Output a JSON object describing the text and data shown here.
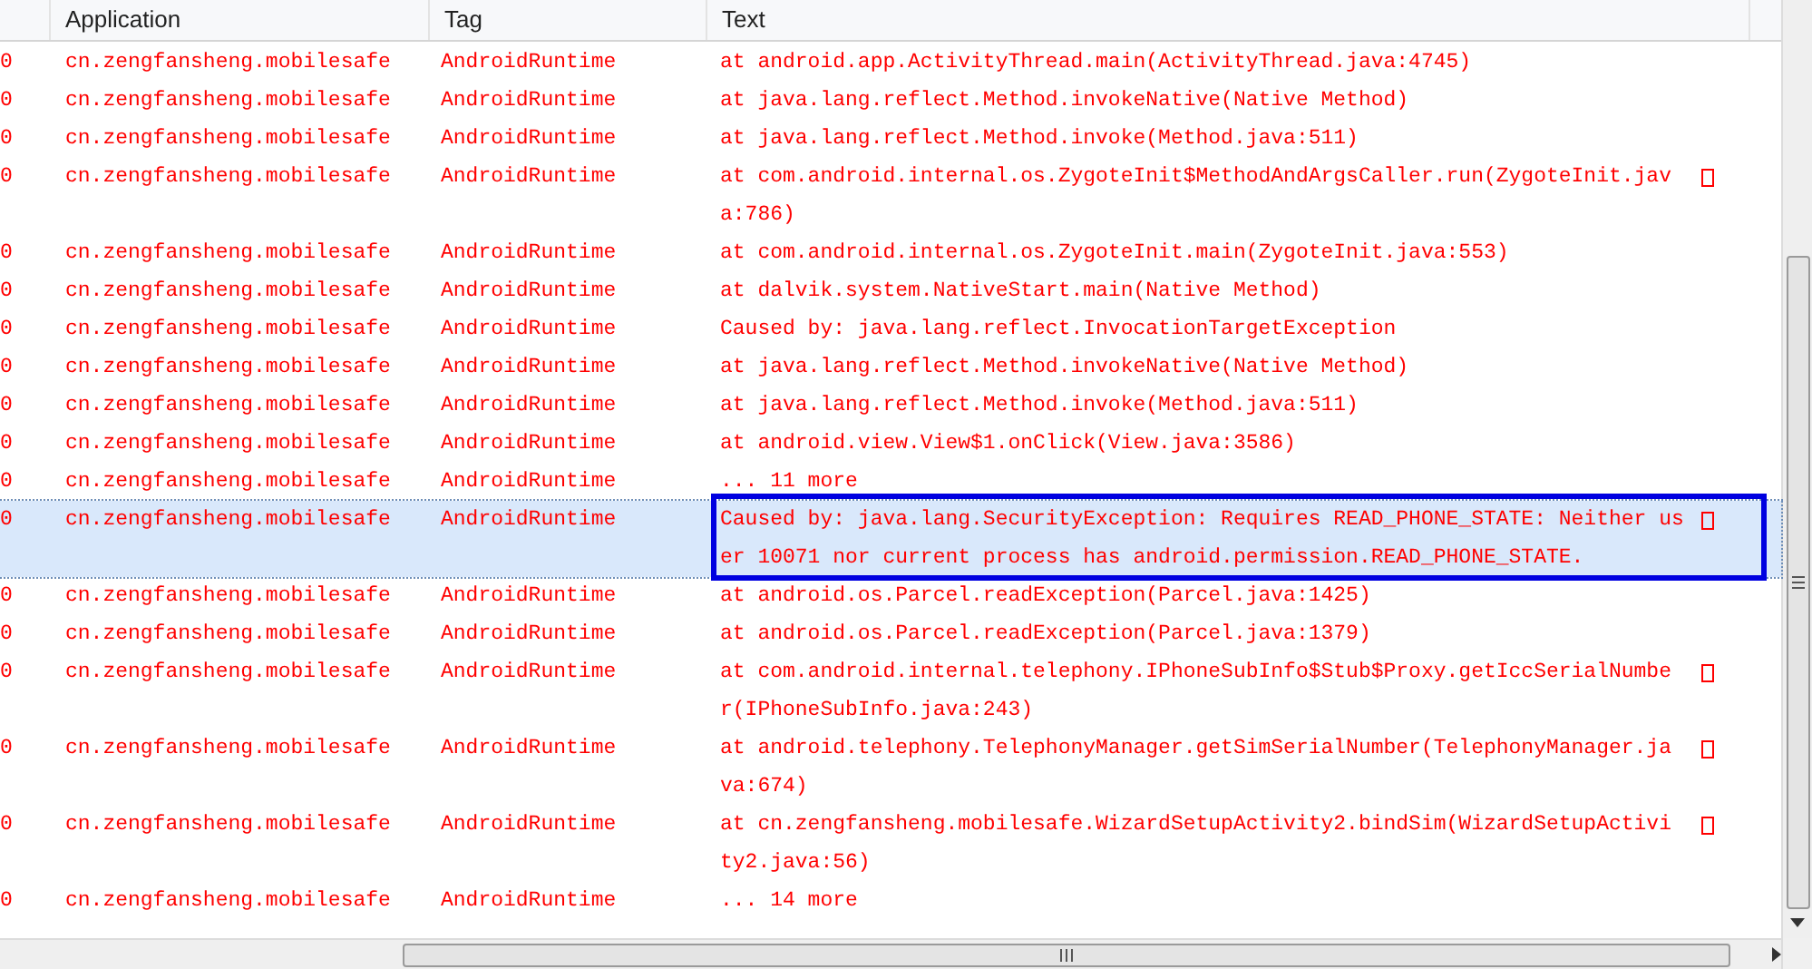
{
  "table": {
    "columns": [
      "Application",
      "Tag",
      "Text"
    ],
    "rows": [
      {
        "column_1": "0",
        "application": "cn.zengfansheng.mobilesafe",
        "tag": "AndroidRuntime",
        "text": [
          "at android.app.ActivityThread.main(ActivityThread.java:4745)"
        ],
        "selected": false
      },
      {
        "column_1": "0",
        "application": "cn.zengfansheng.mobilesafe",
        "tag": "AndroidRuntime",
        "text": [
          "at java.lang.reflect.Method.invokeNative(Native Method)"
        ],
        "selected": false
      },
      {
        "column_1": "0",
        "application": "cn.zengfansheng.mobilesafe",
        "tag": "AndroidRuntime",
        "text": [
          "at java.lang.reflect.Method.invoke(Method.java:511)"
        ],
        "selected": false
      },
      {
        "column_1": "0",
        "application": "cn.zengfansheng.mobilesafe",
        "tag": "AndroidRuntime",
        "text": [
          "at com.android.internal.os.ZygoteInit$MethodAndArgsCaller.run(ZygoteInit.jav",
          "a:786)"
        ],
        "selected": false
      },
      {
        "column_1": "0",
        "application": "cn.zengfansheng.mobilesafe",
        "tag": "AndroidRuntime",
        "text": [
          "at com.android.internal.os.ZygoteInit.main(ZygoteInit.java:553)"
        ],
        "selected": false
      },
      {
        "column_1": "0",
        "application": "cn.zengfansheng.mobilesafe",
        "tag": "AndroidRuntime",
        "text": [
          "at dalvik.system.NativeStart.main(Native Method)"
        ],
        "selected": false
      },
      {
        "column_1": "0",
        "application": "cn.zengfansheng.mobilesafe",
        "tag": "AndroidRuntime",
        "text": [
          "Caused by: java.lang.reflect.InvocationTargetException"
        ],
        "selected": false
      },
      {
        "column_1": "0",
        "application": "cn.zengfansheng.mobilesafe",
        "tag": "AndroidRuntime",
        "text": [
          "at java.lang.reflect.Method.invokeNative(Native Method)"
        ],
        "selected": false
      },
      {
        "column_1": "0",
        "application": "cn.zengfansheng.mobilesafe",
        "tag": "AndroidRuntime",
        "text": [
          "at java.lang.reflect.Method.invoke(Method.java:511)"
        ],
        "selected": false
      },
      {
        "column_1": "0",
        "application": "cn.zengfansheng.mobilesafe",
        "tag": "AndroidRuntime",
        "text": [
          "at android.view.View$1.onClick(View.java:3586)"
        ],
        "selected": false
      },
      {
        "column_1": "0",
        "application": "cn.zengfansheng.mobilesafe",
        "tag": "AndroidRuntime",
        "text": [
          "... 11 more"
        ],
        "selected": false
      },
      {
        "column_1": "0",
        "application": "cn.zengfansheng.mobilesafe",
        "tag": "AndroidRuntime",
        "text": [
          "Caused by: java.lang.SecurityException: Requires READ_PHONE_STATE: Neither us",
          "er 10071 nor current process has android.permission.READ_PHONE_STATE."
        ],
        "selected": true,
        "highlighted": true
      },
      {
        "column_1": "0",
        "application": "cn.zengfansheng.mobilesafe",
        "tag": "AndroidRuntime",
        "text": [
          "at android.os.Parcel.readException(Parcel.java:1425)"
        ],
        "selected": false
      },
      {
        "column_1": "0",
        "application": "cn.zengfansheng.mobilesafe",
        "tag": "AndroidRuntime",
        "text": [
          "at android.os.Parcel.readException(Parcel.java:1379)"
        ],
        "selected": false
      },
      {
        "column_1": "0",
        "application": "cn.zengfansheng.mobilesafe",
        "tag": "AndroidRuntime",
        "text": [
          "at com.android.internal.telephony.IPhoneSubInfo$Stub$Proxy.getIccSerialNumbe",
          "r(IPhoneSubInfo.java:243)"
        ],
        "selected": false
      },
      {
        "column_1": "0",
        "application": "cn.zengfansheng.mobilesafe",
        "tag": "AndroidRuntime",
        "text": [
          "at android.telephony.TelephonyManager.getSimSerialNumber(TelephonyManager.ja",
          "va:674)"
        ],
        "selected": false
      },
      {
        "column_1": "0",
        "application": "cn.zengfansheng.mobilesafe",
        "tag": "AndroidRuntime",
        "text": [
          "at cn.zengfansheng.mobilesafe.WizardSetupActivity2.bindSim(WizardSetupActivi",
          "ty2.java:56)"
        ],
        "selected": false
      },
      {
        "column_1": "0",
        "application": "cn.zengfansheng.mobilesafe",
        "tag": "AndroidRuntime",
        "text": [
          "... 14 more"
        ],
        "selected": false
      }
    ]
  }
}
